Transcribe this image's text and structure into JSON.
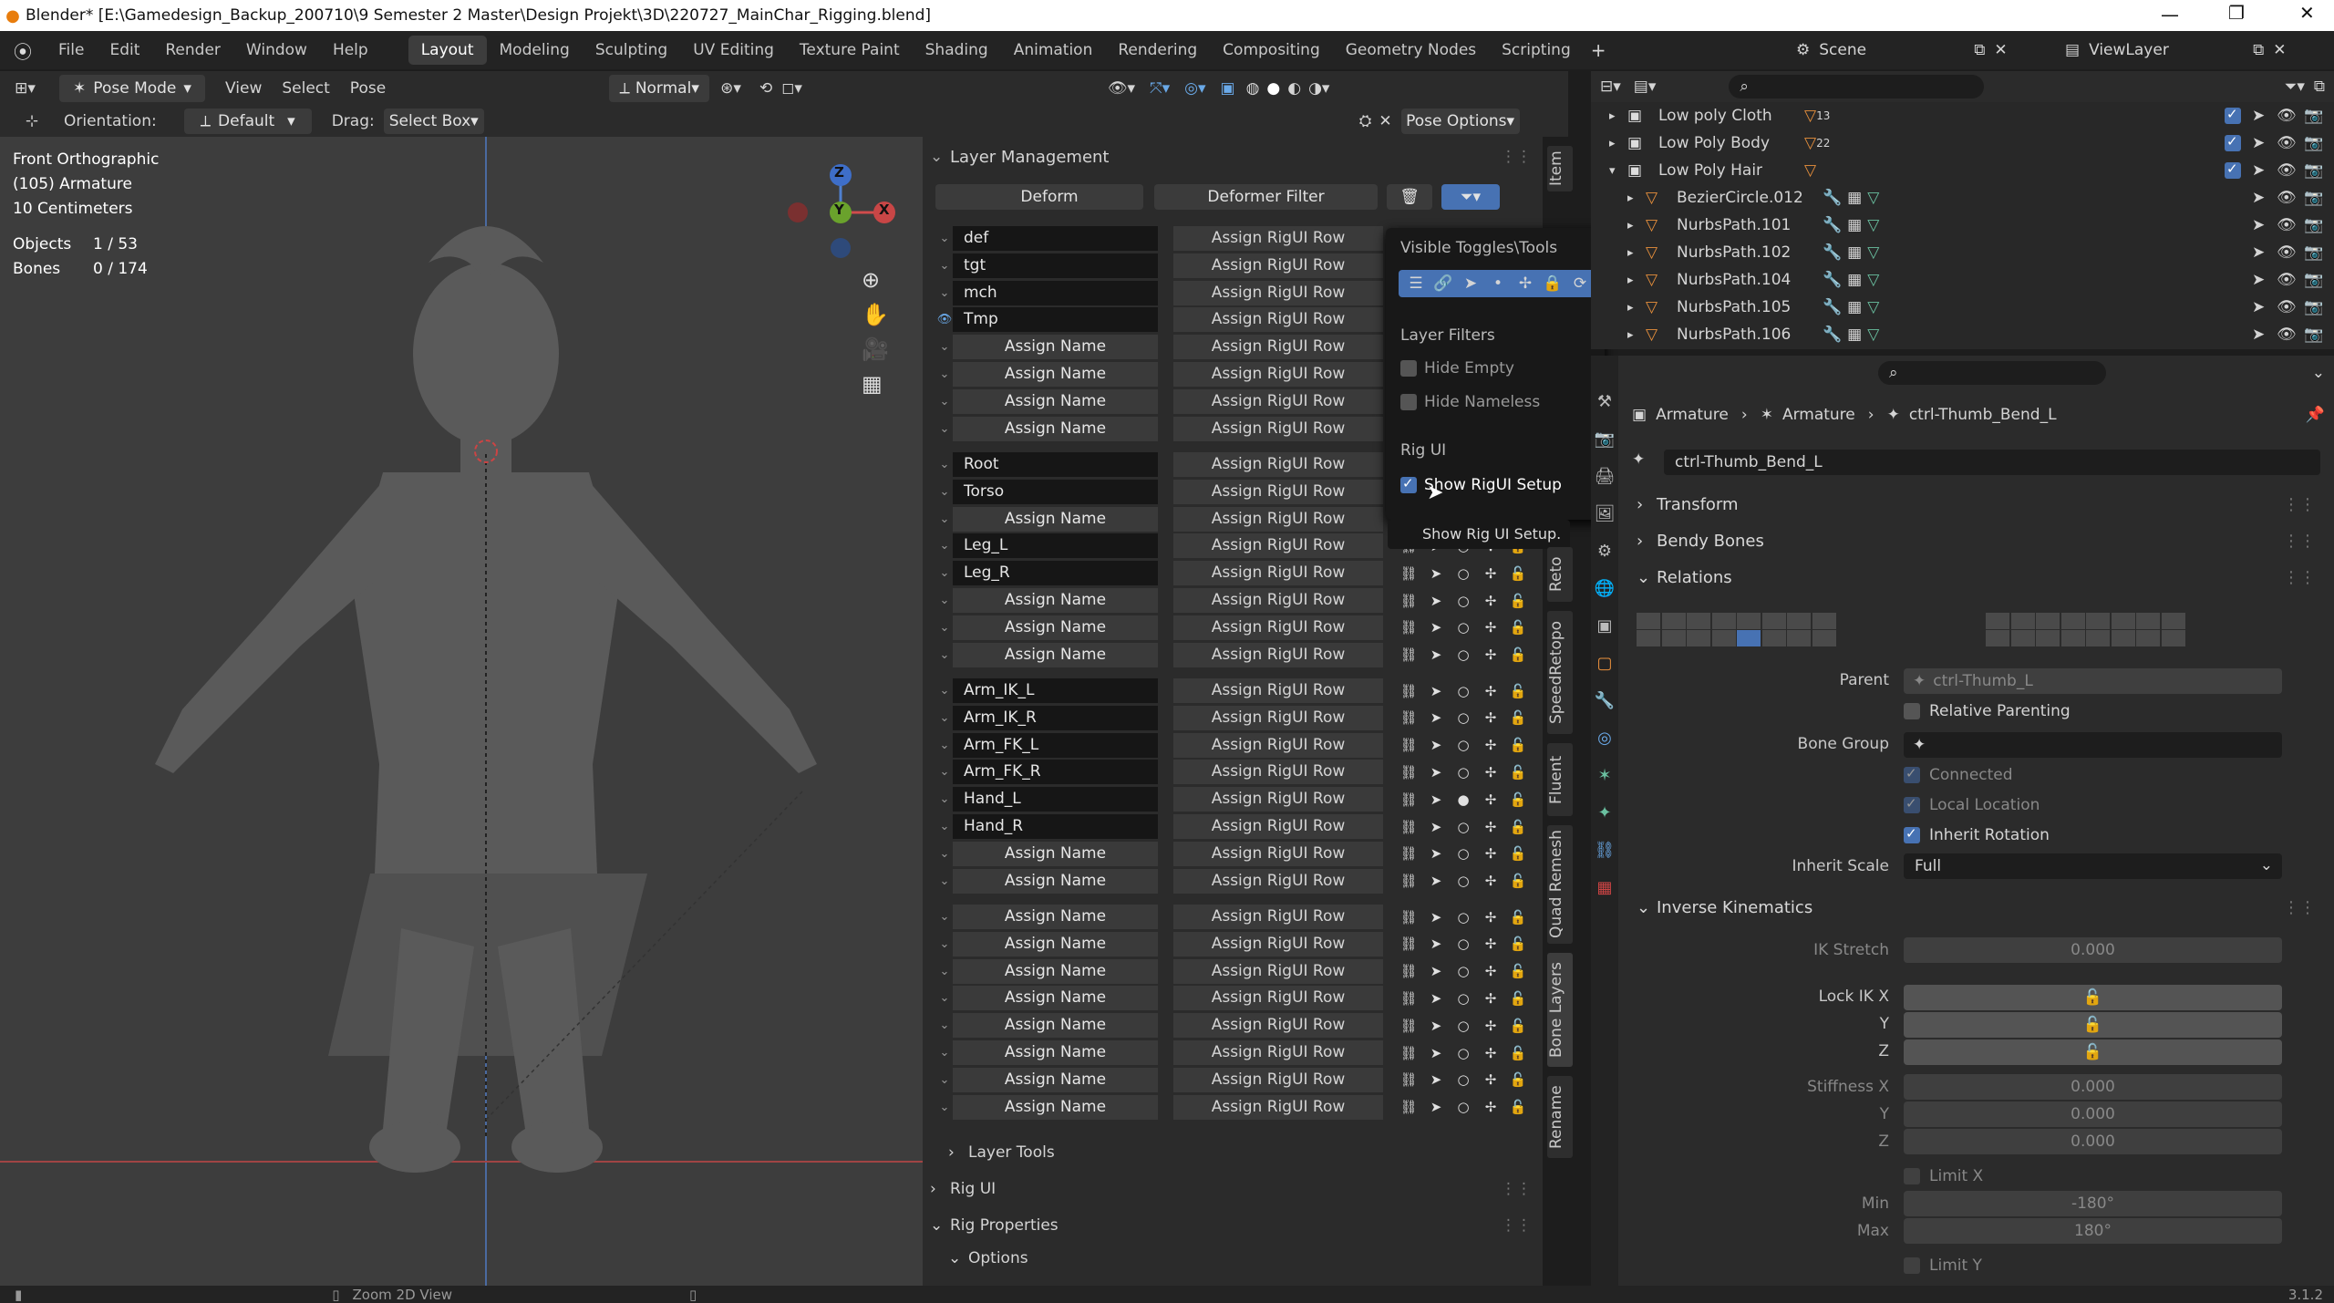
{
  "window": {
    "title": "Blender* [E:\\Gamedesign_Backup_200710\\9 Semester 2 Master\\Design Projekt\\3D\\220727_MainChar_Rigging.blend]"
  },
  "menu": [
    "File",
    "Edit",
    "Render",
    "Window",
    "Help"
  ],
  "workspaces": [
    "Layout",
    "Modeling",
    "Sculpting",
    "UV Editing",
    "Texture Paint",
    "Shading",
    "Animation",
    "Rendering",
    "Compositing",
    "Geometry Nodes",
    "Scripting"
  ],
  "scene": "Scene",
  "viewlayer": "ViewLayer",
  "header": {
    "mode": "Pose Mode",
    "view": "View",
    "select": "Select",
    "pose": "Pose",
    "pivot": "Normal",
    "orientation_label": "Orientation:",
    "orientation": "Default",
    "drag_label": "Drag:",
    "drag": "Select Box",
    "pose_options": "Pose Options"
  },
  "viewport": {
    "view_name": "Front Orthographic",
    "object_name": "(105) Armature",
    "scale": "10 Centimeters",
    "objects_label": "Objects",
    "objects": "1 / 53",
    "bones_label": "Bones",
    "bones": "0 / 174"
  },
  "gizmo": {
    "z": "Z",
    "y": "Y",
    "x": "X"
  },
  "layer_panel": {
    "title": "Layer Management",
    "deform": "Deform",
    "deformer_filter": "Deformer Filter",
    "rows": [
      {
        "name": "def",
        "assign": "Assign RigUI Row",
        "indent": false,
        "eye": false
      },
      {
        "name": "tgt",
        "assign": "Assign RigUI Row",
        "indent": false,
        "eye": false
      },
      {
        "name": "mch",
        "assign": "Assign RigUI Row",
        "indent": false,
        "eye": false
      },
      {
        "name": "Tmp",
        "assign": "Assign RigUI Row",
        "indent": false,
        "eye": true
      },
      {
        "name": "Assign Name",
        "assign": "Assign RigUI Row",
        "indent": true
      },
      {
        "name": "Assign Name",
        "assign": "Assign RigUI Row",
        "indent": true
      },
      {
        "name": "Assign Name",
        "assign": "Assign RigUI Row",
        "indent": true
      },
      {
        "name": "Assign Name",
        "assign": "Assign RigUI Row",
        "indent": true
      }
    ],
    "rows2": [
      {
        "name": "Root",
        "assign": "Assign RigUI Row",
        "indent": false
      },
      {
        "name": "Torso",
        "assign": "Assign RigUI Row",
        "indent": false
      },
      {
        "name": "Assign Name",
        "assign": "Assign RigUI Row",
        "indent": true
      },
      {
        "name": "Leg_L",
        "assign": "Assign RigUI Row",
        "indent": false
      },
      {
        "name": "Leg_R",
        "assign": "Assign RigUI Row",
        "indent": false
      },
      {
        "name": "Assign Name",
        "assign": "Assign RigUI Row",
        "indent": true
      },
      {
        "name": "Assign Name",
        "assign": "Assign RigUI Row",
        "indent": true
      },
      {
        "name": "Assign Name",
        "assign": "Assign RigUI Row",
        "indent": true
      }
    ],
    "rows3": [
      {
        "name": "Arm_IK_L",
        "assign": "Assign RigUI Row",
        "indent": false
      },
      {
        "name": "Arm_IK_R",
        "assign": "Assign RigUI Row",
        "indent": false
      },
      {
        "name": "Arm_FK_L",
        "assign": "Assign RigUI Row",
        "indent": false
      },
      {
        "name": "Arm_FK_R",
        "assign": "Assign RigUI Row",
        "indent": false
      },
      {
        "name": "Hand_L",
        "assign": "Assign RigUI Row",
        "indent": false
      },
      {
        "name": "Hand_R",
        "assign": "Assign RigUI Row",
        "indent": false
      },
      {
        "name": "Assign Name",
        "assign": "Assign RigUI Row",
        "indent": true
      },
      {
        "name": "Assign Name",
        "assign": "Assign RigUI Row",
        "indent": true
      }
    ],
    "rows4": [
      {
        "name": "Assign Name",
        "assign": "Assign RigUI Row",
        "indent": true
      },
      {
        "name": "Assign Name",
        "assign": "Assign RigUI Row",
        "indent": true
      },
      {
        "name": "Assign Name",
        "assign": "Assign RigUI Row",
        "indent": true
      },
      {
        "name": "Assign Name",
        "assign": "Assign RigUI Row",
        "indent": true
      },
      {
        "name": "Assign Name",
        "assign": "Assign RigUI Row",
        "indent": true
      },
      {
        "name": "Assign Name",
        "assign": "Assign RigUI Row",
        "indent": true
      },
      {
        "name": "Assign Name",
        "assign": "Assign RigUI Row",
        "indent": true
      },
      {
        "name": "Assign Name",
        "assign": "Assign RigUI Row",
        "indent": true
      }
    ],
    "layer_tools": "Layer Tools",
    "rig_ui": "Rig UI",
    "rig_properties": "Rig Properties",
    "options": "Options"
  },
  "popup": {
    "visible_toggles": "Visible Toggles\\Tools",
    "layer_filters": "Layer Filters",
    "hide_empty": "Hide Empty",
    "hide_nameless": "Hide Nameless",
    "rig_ui": "Rig UI",
    "show_rigui_setup": "Show RigUI Setup",
    "tooltip": "Show Rig UI Setup."
  },
  "side_tabs": [
    "Item",
    "Reto",
    "SpeedRetopo",
    "Fluent",
    "Quad Remesh",
    "Bone Layers",
    "Rename"
  ],
  "outliner": [
    {
      "name": "Low poly Cloth",
      "badge": "13",
      "level": 0,
      "expanded": false
    },
    {
      "name": "Low Poly Body",
      "badge": "22",
      "level": 0,
      "expanded": false
    },
    {
      "name": "Low Poly Hair",
      "badge": "",
      "level": 0,
      "expanded": true
    },
    {
      "name": "BezierCircle.012",
      "level": 1
    },
    {
      "name": "NurbsPath.101",
      "level": 1
    },
    {
      "name": "NurbsPath.102",
      "level": 1
    },
    {
      "name": "NurbsPath.104",
      "level": 1
    },
    {
      "name": "NurbsPath.105",
      "level": 1
    },
    {
      "name": "NurbsPath.106",
      "level": 1
    }
  ],
  "properties": {
    "breadcrumb": [
      "Armature",
      "Armature",
      "ctrl-Thumb_Bend_L"
    ],
    "bone_name": "ctrl-Thumb_Bend_L",
    "transform": "Transform",
    "bendy": "Bendy Bones",
    "relations": "Relations",
    "parent_label": "Parent",
    "parent": "ctrl-Thumb_L",
    "relative_parenting": "Relative Parenting",
    "bone_group_label": "Bone Group",
    "connected": "Connected",
    "local_location": "Local Location",
    "inherit_rotation": "Inherit Rotation",
    "inherit_scale_label": "Inherit Scale",
    "inherit_scale": "Full",
    "ik": "Inverse Kinematics",
    "ik_stretch_label": "IK Stretch",
    "ik_stretch": "0.000",
    "lock_ik_x": "Lock IK X",
    "y": "Y",
    "z": "Z",
    "stiffness_x": "Stiffness X",
    "stiffness_vals": [
      "0.000",
      "0.000",
      "0.000"
    ],
    "limit_x": "Limit X",
    "min_label": "Min",
    "min": "-180°",
    "max_label": "Max",
    "max": "180°",
    "limit_y": "Limit Y"
  },
  "status": {
    "zoom": "Zoom 2D View",
    "version": "3.1.2"
  }
}
